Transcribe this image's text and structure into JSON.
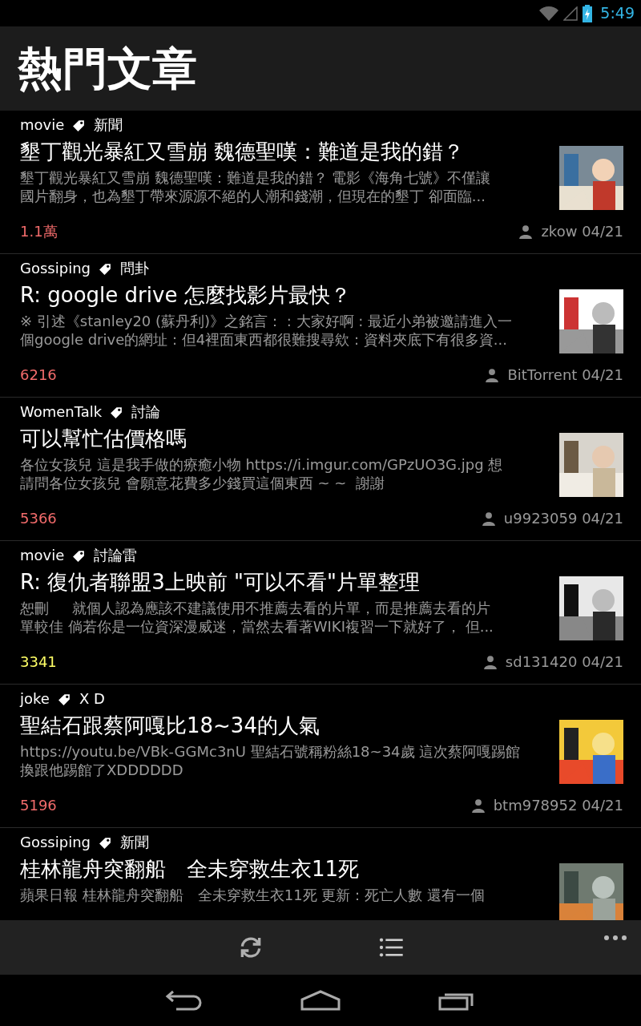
{
  "status_bar": {
    "time": "5:49"
  },
  "header": {
    "title": "熱門文章"
  },
  "articles": [
    {
      "board": "movie",
      "tag": "新聞",
      "title": "墾丁觀光暴紅又雪崩 魏德聖嘆：難道是我的錯？",
      "snippet": [
        "墾丁觀光暴紅又雪崩 魏德聖嘆：難道是我的錯？ 電影《海角七號》不僅讓",
        "國片翻身，也為墾丁帶來源源不絕的人潮和錢潮，但現在的墾丁 卻面臨..."
      ],
      "count": "1.1萬",
      "color": "#f26b6b",
      "author": "zkow",
      "date": "04/21",
      "thumbnail": {
        "kind": "picture"
      }
    },
    {
      "board": "Gossiping",
      "tag": "問卦",
      "title": "R: google drive 怎麼找影片最快？",
      "snippet": [
        "※ 引述《stanley20 (蘇丹利)》之銘言： : 大家好啊 : 最近小弟被邀請進入一",
        "個google drive的網址 : 但4裡面東西都很難搜尋欸 : 資料夾底下有很多資..."
      ],
      "count": "6216",
      "color": "#f26b6b",
      "author": "BitTorrent",
      "date": "04/21",
      "thumbnail": {
        "kind": "picture"
      }
    },
    {
      "board": "WomenTalk",
      "tag": "討論",
      "title": "可以幫忙估價格嗎",
      "snippet": [
        "各位女孩兒 這是我手做的療癒小物 https://i.imgur.com/GPzUO3G.jpg 想",
        "請問各位女孩兒 會願意花費多少錢買這個東西 ~ ~  謝謝"
      ],
      "count": "5366",
      "color": "#f26b6b",
      "author": "u9923059",
      "date": "04/21",
      "thumbnail": {
        "kind": "picture"
      }
    },
    {
      "board": "movie",
      "tag": "討論雷",
      "title": "R: 復仇者聯盟3上映前 \"可以不看\"片單整理",
      "snippet": [
        "恕刪     就個人認為應該不建議使用不推薦去看的片單，而是推薦去看的片",
        "單較佳 倘若你是一位資深漫威迷，當然去看著WIKI複習一下就好了， 但..."
      ],
      "count": "3341",
      "color": "#ffff66",
      "author": "sd131420",
      "date": "04/21",
      "thumbnail": {
        "kind": "picture"
      }
    },
    {
      "board": "joke",
      "tag": "X D",
      "title": "聖結石跟蔡阿嘎比18~34的人氣",
      "snippet": [
        "https://youtu.be/VBk-GGMc3nU 聖結石號稱粉絲18~34歲 這次蔡阿嘎踢館",
        "換跟他踢館了XDDDDDD"
      ],
      "count": "5196",
      "color": "#f26b6b",
      "author": "btm978952",
      "date": "04/21",
      "thumbnail": {
        "kind": "picture"
      }
    },
    {
      "board": "Gossiping",
      "tag": "新聞",
      "title": "桂林龍舟突翻船　全未穿救生衣11死",
      "snippet": [
        "蘋果日報 桂林龍舟突翻船　全未穿救生衣11死 更新：死亡人數 還有一個"
      ],
      "thumbnail": {
        "kind": "picture"
      }
    }
  ]
}
